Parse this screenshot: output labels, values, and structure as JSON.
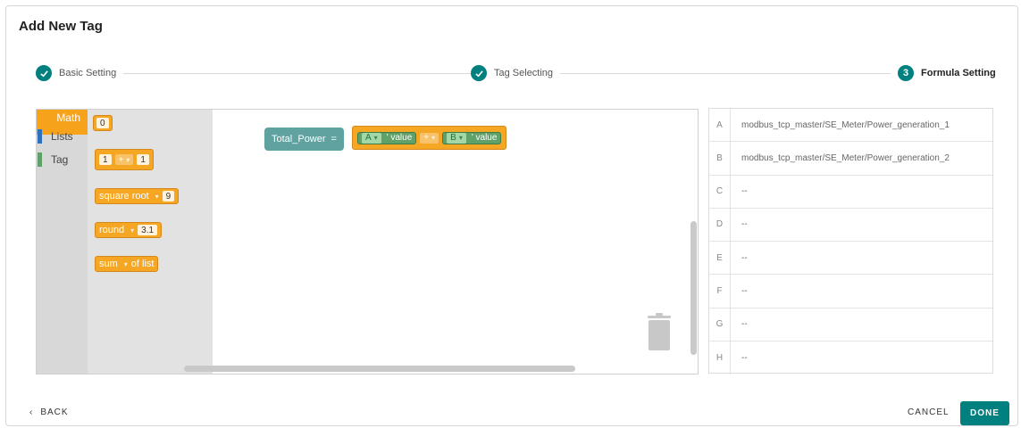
{
  "dialog": {
    "title": "Add New Tag"
  },
  "stepper": {
    "steps": [
      {
        "number": "",
        "label": "Basic Setting",
        "state": "completed"
      },
      {
        "number": "",
        "label": "Tag Selecting",
        "state": "completed"
      },
      {
        "number": "3",
        "label": "Formula Setting",
        "state": "active"
      }
    ],
    "accent_color": "#00807f"
  },
  "toolbox": {
    "categories": [
      {
        "label": "Math",
        "color": "#f7a21b"
      },
      {
        "label": "Lists",
        "color": "#2f6fbd"
      },
      {
        "label": "Tag",
        "color": "#5fa169"
      }
    ]
  },
  "flyout": {
    "number_block": "0",
    "arith_block": {
      "left": "1",
      "op": "+",
      "right": "1"
    },
    "sqrt_block": {
      "op": "square root",
      "value": "9"
    },
    "round_block": {
      "op": "round",
      "value": "3.1"
    },
    "sum_block": {
      "op": "sum",
      "suffix": "of list"
    }
  },
  "canvas": {
    "variable": "Total_Power",
    "assign": "=",
    "formula": {
      "left_tag": "A",
      "left_field": "' value",
      "operator": "+",
      "right_tag": "B",
      "right_field": "' value"
    }
  },
  "tag_list": [
    {
      "key": "A",
      "value": "modbus_tcp_master/SE_Meter/Power_generation_1"
    },
    {
      "key": "B",
      "value": "modbus_tcp_master/SE_Meter/Power_generation_2"
    },
    {
      "key": "C",
      "value": "--"
    },
    {
      "key": "D",
      "value": "--"
    },
    {
      "key": "E",
      "value": "--"
    },
    {
      "key": "F",
      "value": "--"
    },
    {
      "key": "G",
      "value": "--"
    },
    {
      "key": "H",
      "value": "--"
    }
  ],
  "footer": {
    "back_label": "BACK",
    "cancel_label": "CANCEL",
    "done_label": "DONE"
  }
}
